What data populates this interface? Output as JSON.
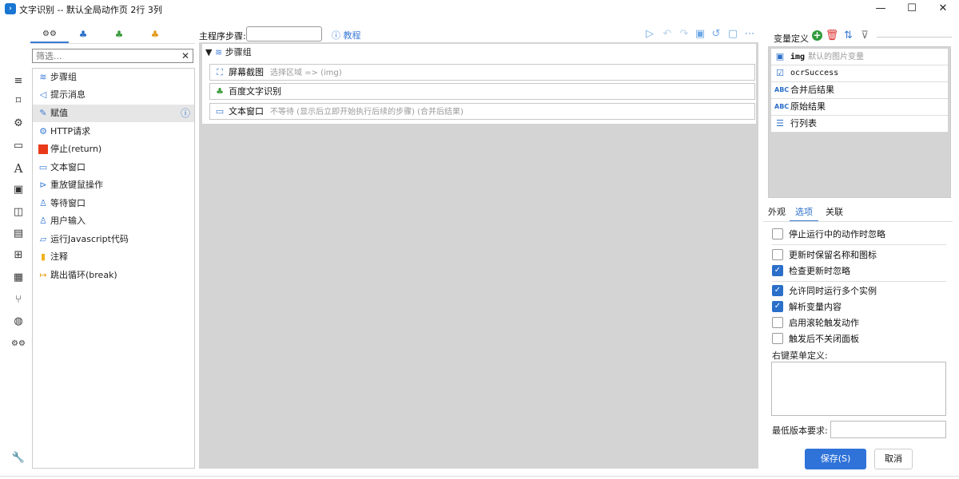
{
  "window": {
    "title": "文字识别 -- 默认全局动作页 2行 3列",
    "minimize_glyph": "—",
    "maximize_glyph": "☐",
    "close_glyph": "✕"
  },
  "rail_icons": [
    "menu-icon",
    "bookmark-icon",
    "settings-icon",
    "window-icon",
    "font-icon",
    "image-icon",
    "clipboard-icon",
    "document-icon",
    "windows-icon",
    "grid-icon",
    "git-branch-icon",
    "globe-icon",
    "gears-icon",
    "wrench-icon"
  ],
  "top_tabs": [
    {
      "icon": "gears-icon",
      "selected": true
    },
    {
      "icon": "triad-blue-icon",
      "selected": false
    },
    {
      "icon": "triad-green-icon",
      "selected": false
    },
    {
      "icon": "triad-orange-icon",
      "selected": false
    }
  ],
  "filter": {
    "placeholder": "筛选...",
    "clear_glyph": "✕"
  },
  "actions": [
    {
      "label": "步骤组",
      "icon": "layers-icon"
    },
    {
      "label": "提示消息",
      "icon": "megaphone-icon"
    },
    {
      "label": "赋值",
      "icon": "edit-icon",
      "selected": true
    },
    {
      "label": "HTTP请求",
      "icon": "settings-icon"
    },
    {
      "label": "停止(return)",
      "icon": "stop-icon"
    },
    {
      "label": "文本窗口",
      "icon": "window-icon"
    },
    {
      "label": "重放键鼠操作",
      "icon": "play-icon"
    },
    {
      "label": "等待窗口",
      "icon": "user-icon"
    },
    {
      "label": "用户输入",
      "icon": "user-icon"
    },
    {
      "label": "运行Javascript代码",
      "icon": "chat-icon"
    },
    {
      "label": "注释",
      "icon": "note-icon"
    },
    {
      "label": "跳出循环(break)",
      "icon": "exit-icon"
    }
  ],
  "step_toolbar": {
    "label": "主程序步骤:",
    "input_value": "",
    "tutorial": "教程",
    "icons": [
      "play-icon",
      "undo-icon",
      "redo-icon",
      "save-icon",
      "history-icon",
      "note-icon",
      "more-icon"
    ]
  },
  "steps": {
    "group": {
      "name": "步骤组"
    },
    "items": [
      {
        "name": "屏幕截图",
        "desc": "选择区域 => (img)",
        "icon": "screenshot-icon"
      },
      {
        "name": "百度文字识别",
        "desc": "",
        "icon": "triad-green-icon"
      },
      {
        "name": "文本窗口",
        "desc": "不等待 (显示后立即开始执行后续的步骤) (合并后结果)",
        "icon": "window-icon"
      }
    ]
  },
  "variables": {
    "title": "变量定义",
    "items": [
      {
        "name": "img",
        "desc": "默认的图片变量",
        "icon": "image-icon"
      },
      {
        "name": "ocrSuccess",
        "desc": "",
        "icon": "checkbox-icon"
      },
      {
        "name": "合并后结果",
        "desc": "",
        "icon": "abc-icon"
      },
      {
        "name": "原始结果",
        "desc": "",
        "icon": "abc-icon"
      },
      {
        "name": "行列表",
        "desc": "",
        "icon": "list-icon"
      }
    ]
  },
  "right_tabs": [
    "外观",
    "选项",
    "关联"
  ],
  "options": [
    {
      "label": "停止运行中的动作时忽略",
      "checked": false
    },
    {
      "label": "更新时保留名称和图标",
      "checked": false
    },
    {
      "label": "检查更新时忽略",
      "checked": true
    },
    {
      "label": "允许同时运行多个实例",
      "checked": true
    },
    {
      "label": "解析变量内容",
      "checked": true
    },
    {
      "label": "启用滚轮触发动作",
      "checked": false
    },
    {
      "label": "触发后不关闭面板",
      "checked": false
    }
  ],
  "context_menu_label": "右键菜单定义:",
  "context_menu_value": "",
  "min_version_label": "最低版本要求:",
  "min_version_value": "",
  "buttons": {
    "save": "保存(S)",
    "cancel": "取消"
  },
  "glyphs": {
    "expand": "▼",
    "info": "ⓘ",
    "check": "✓",
    "add": "+",
    "delete": "🗑",
    "sort": "⇅",
    "filter": "⊽"
  }
}
